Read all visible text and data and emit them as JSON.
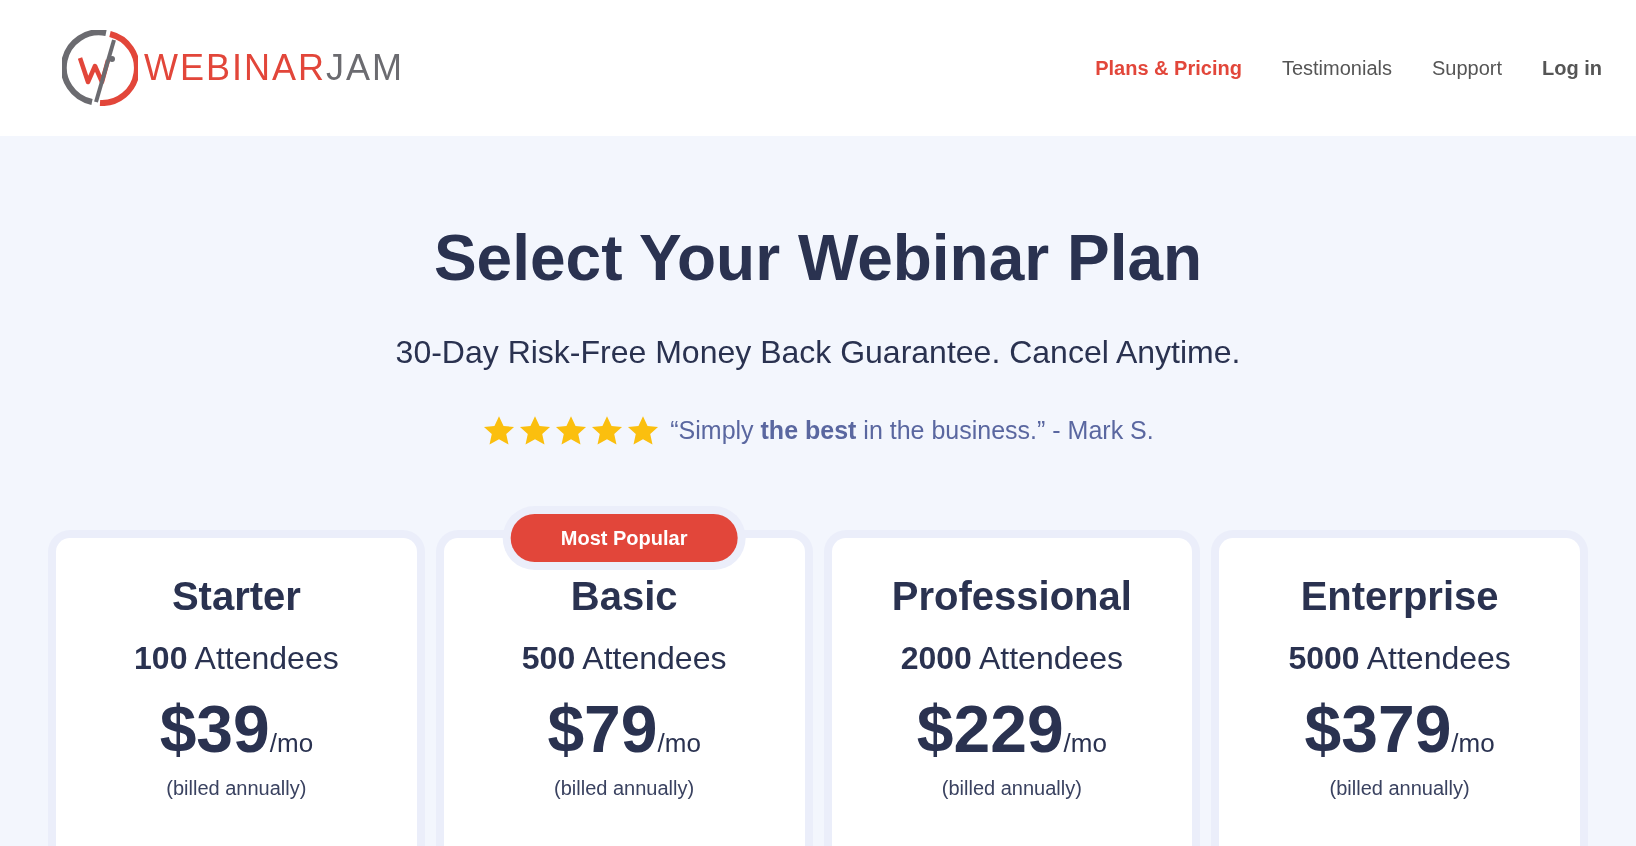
{
  "logo": {
    "primary": "WEBINAR",
    "secondary": "JAM"
  },
  "nav": [
    {
      "label": "Plans & Pricing",
      "selected": true,
      "kind": "link"
    },
    {
      "label": "Testimonials",
      "selected": false,
      "kind": "link"
    },
    {
      "label": "Support",
      "selected": false,
      "kind": "link"
    },
    {
      "label": "Log in",
      "selected": false,
      "kind": "login"
    }
  ],
  "hero": {
    "title": "Select Your Webinar Plan",
    "subtitle": "30-Day Risk-Free Money Back Guarantee. Cancel Anytime.",
    "rating": {
      "stars": 5,
      "quote": "“Simply **the best** in the business.” - Mark S."
    }
  },
  "plans": [
    {
      "name": "Starter",
      "attendees": "**100** Attendees",
      "price": "$39",
      "period": "/mo",
      "billing": "(billed annually)"
    },
    {
      "name": "Basic",
      "badge": "Most Popular",
      "attendees": "**500** Attendees",
      "price": "$79",
      "period": "/mo",
      "billing": "(billed annually)"
    },
    {
      "name": "Professional",
      "attendees": "**2000** Attendees",
      "price": "$229",
      "period": "/mo",
      "billing": "(billed annually)"
    },
    {
      "name": "Enterprise",
      "attendees": "**5000** Attendees",
      "price": "$379",
      "period": "/mo",
      "billing": "(billed annually)"
    }
  ]
}
